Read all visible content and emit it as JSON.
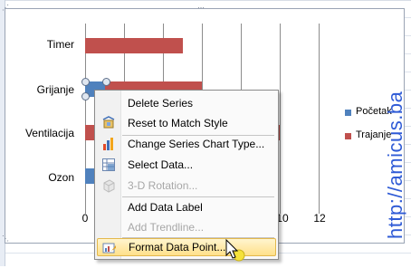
{
  "chart_data": {
    "type": "bar",
    "categories": [
      "Timer",
      "Grijanje",
      "Ventilacija",
      "Ozon"
    ],
    "series": [
      {
        "name": "Početak",
        "color": "#4f81bd",
        "values": [
          0,
          1,
          0,
          1
        ]
      },
      {
        "name": "Trajanje",
        "color": "#c0504d",
        "values": [
          5,
          5,
          10,
          5
        ]
      }
    ],
    "x_ticks": [
      "0",
      "10",
      "12"
    ],
    "xlim": [
      0,
      12
    ],
    "grid": true,
    "legend_position": "right"
  },
  "context_menu": {
    "items": [
      {
        "label": "Delete Series",
        "icon": "none",
        "enabled": true
      },
      {
        "label": "Reset to Match Style",
        "icon": "reset-style-icon",
        "enabled": true
      },
      {
        "label": "Change Series Chart Type...",
        "icon": "chart-type-icon",
        "enabled": true
      },
      {
        "label": "Select Data...",
        "icon": "select-data-icon",
        "enabled": true
      },
      {
        "label": "3-D Rotation...",
        "icon": "rotation-3d-icon",
        "enabled": false
      },
      {
        "label": "Add Data Label",
        "icon": "none",
        "enabled": true
      },
      {
        "label": "Add Trendline...",
        "icon": "none",
        "enabled": false
      },
      {
        "label": "Format Data Point...",
        "icon": "format-point-icon",
        "enabled": true,
        "highlighted": true
      }
    ]
  },
  "watermark": "http://amicus.ba"
}
